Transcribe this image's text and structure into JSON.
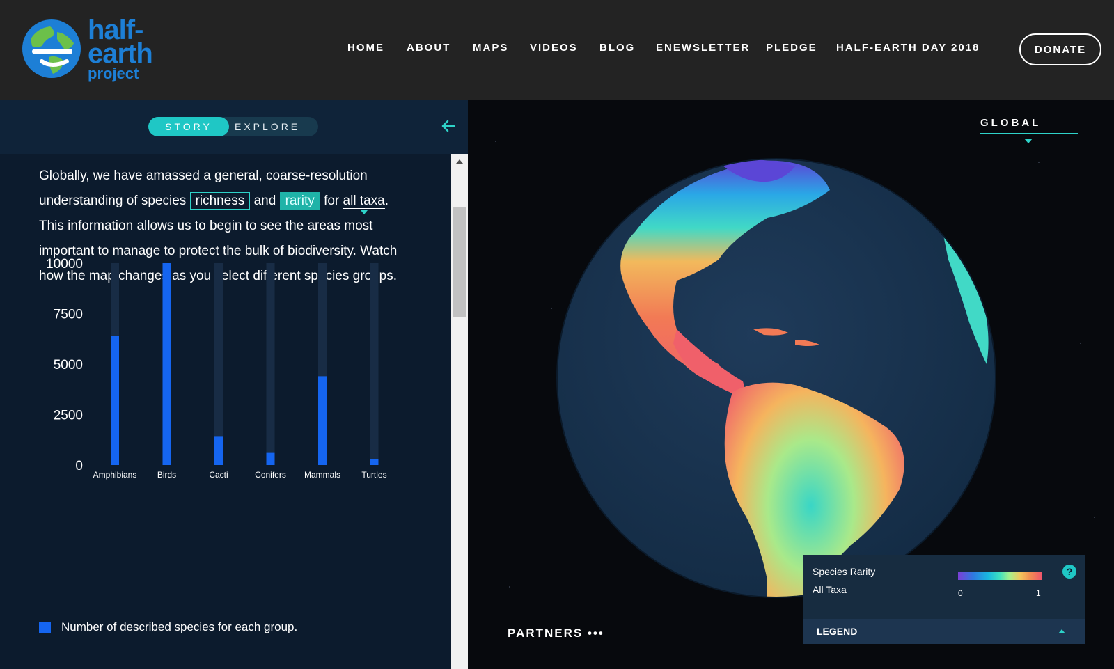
{
  "header": {
    "logo": {
      "line1": "half-",
      "line2": "earth",
      "line3": "project"
    },
    "nav": [
      "HOME",
      "ABOUT",
      "MAPS",
      "VIDEOS",
      "BLOG",
      "ENEWSLETTER",
      "PLEDGE",
      "HALF-EARTH DAY 2018"
    ],
    "donate_label": "DONATE"
  },
  "panel": {
    "tabs": {
      "story": "STORY",
      "explore": "EXPLORE"
    },
    "text": {
      "part1": "Globally, we have amassed a general, coarse-resolution understanding of species",
      "richness": "richness",
      "and": "and",
      "rarity": "rarity",
      "for": "for",
      "all_taxa": "all taxa",
      "period": ".",
      "part2": "This information allows us to begin to see the areas most important to manage to protect the bulk of biodiversity. Watch how the map changes as you select different species groups."
    },
    "legend_label": "Number of described species for each group."
  },
  "chart_data": {
    "type": "bar",
    "categories": [
      "Amphibians",
      "Birds",
      "Cacti",
      "Conifers",
      "Mammals",
      "Turtles"
    ],
    "values": [
      6400,
      10000,
      1400,
      600,
      4400,
      300
    ],
    "ylim": [
      0,
      10000
    ],
    "yticks": [
      0,
      2500,
      5000,
      7500,
      10000
    ],
    "colors": {
      "bar": "#1565f0",
      "track": "#182c45"
    },
    "legend": "Number of described species for each group."
  },
  "map": {
    "scope_label": "GLOBAL",
    "partners_label": "PARTNERS •••",
    "legend": {
      "title": "Species Rarity",
      "subtitle": "All Taxa",
      "min": "0",
      "max": "1",
      "help": "?",
      "footer": "LEGEND"
    }
  },
  "colors": {
    "accent": "#2ed3c9",
    "panel": "#0c1b2d",
    "header": "#232323"
  }
}
